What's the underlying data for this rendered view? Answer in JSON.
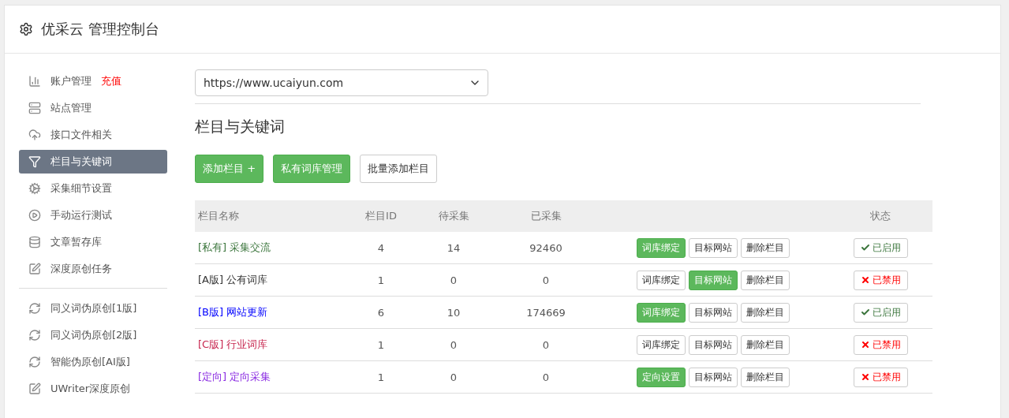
{
  "header": {
    "title": "优采云 管理控制台"
  },
  "sidebar": {
    "items": [
      {
        "kind": "chart",
        "label": "账户管理",
        "badge": "充值",
        "selected": false
      },
      {
        "kind": "server",
        "label": "站点管理",
        "selected": false
      },
      {
        "kind": "cloud",
        "label": "接口文件相关",
        "selected": false
      },
      {
        "kind": "filter",
        "label": "栏目与关键词",
        "selected": true
      },
      {
        "kind": "gears",
        "label": "采集细节设置",
        "selected": false
      },
      {
        "kind": "play",
        "label": "手动运行测试",
        "selected": false
      },
      {
        "kind": "database",
        "label": "文章暂存库",
        "selected": false
      },
      {
        "kind": "edit",
        "label": "深度原创任务",
        "selected": false
      },
      {
        "kind": "divider"
      },
      {
        "kind": "refresh",
        "label": "同义词伪原创[1版]",
        "selected": false
      },
      {
        "kind": "refresh",
        "label": "同义词伪原创[2版]",
        "selected": false
      },
      {
        "kind": "refresh",
        "label": "智能伪原创[AI版]",
        "selected": false
      },
      {
        "kind": "edit",
        "label": "UWriter深度原创",
        "selected": false
      }
    ]
  },
  "site_select": {
    "value": "https://www.ucaiyun.com"
  },
  "section_title": "栏目与关键词",
  "toolbar": [
    {
      "label": "添加栏目 +",
      "primary": true
    },
    {
      "label": "私有词库管理",
      "primary": true
    },
    {
      "label": "批量添加栏目",
      "primary": false
    }
  ],
  "table": {
    "columns": [
      "栏目名称",
      "栏目ID",
      "待采集",
      "已采集",
      "",
      "状态"
    ],
    "rows": [
      {
        "tag": "[私有]",
        "name": "采集交流",
        "color": "#3c763d",
        "id": "4",
        "pending": "14",
        "collected": "92460",
        "actions": [
          {
            "label": "词库绑定",
            "primary": true
          },
          {
            "label": "目标网站",
            "primary": false
          },
          {
            "label": "删除栏目",
            "primary": false
          }
        ],
        "status": "已启用",
        "enabled": true
      },
      {
        "tag": "[A版]",
        "name": "公有词库",
        "color": "#333333",
        "id": "1",
        "pending": "0",
        "collected": "0",
        "actions": [
          {
            "label": "词库绑定",
            "primary": false
          },
          {
            "label": "目标网站",
            "primary": true
          },
          {
            "label": "删除栏目",
            "primary": false
          }
        ],
        "status": "已禁用",
        "enabled": false
      },
      {
        "tag": "[B版]",
        "name": "网站更新",
        "color": "#0000ff",
        "id": "6",
        "pending": "10",
        "collected": "174669",
        "actions": [
          {
            "label": "词库绑定",
            "primary": true
          },
          {
            "label": "目标网站",
            "primary": false
          },
          {
            "label": "删除栏目",
            "primary": false
          }
        ],
        "status": "已启用",
        "enabled": true
      },
      {
        "tag": "[C版]",
        "name": "行业词库",
        "color": "#c7254e",
        "id": "1",
        "pending": "0",
        "collected": "0",
        "actions": [
          {
            "label": "词库绑定",
            "primary": false
          },
          {
            "label": "目标网站",
            "primary": false
          },
          {
            "label": "删除栏目",
            "primary": false
          }
        ],
        "status": "已禁用",
        "enabled": false
      },
      {
        "tag": "[定向]",
        "name": "定向采集",
        "color": "#8a2be2",
        "id": "1",
        "pending": "0",
        "collected": "0",
        "actions": [
          {
            "label": "定向设置",
            "primary": true
          },
          {
            "label": "目标网站",
            "primary": false
          },
          {
            "label": "删除栏目",
            "primary": false
          }
        ],
        "status": "已禁用",
        "enabled": false
      }
    ]
  }
}
